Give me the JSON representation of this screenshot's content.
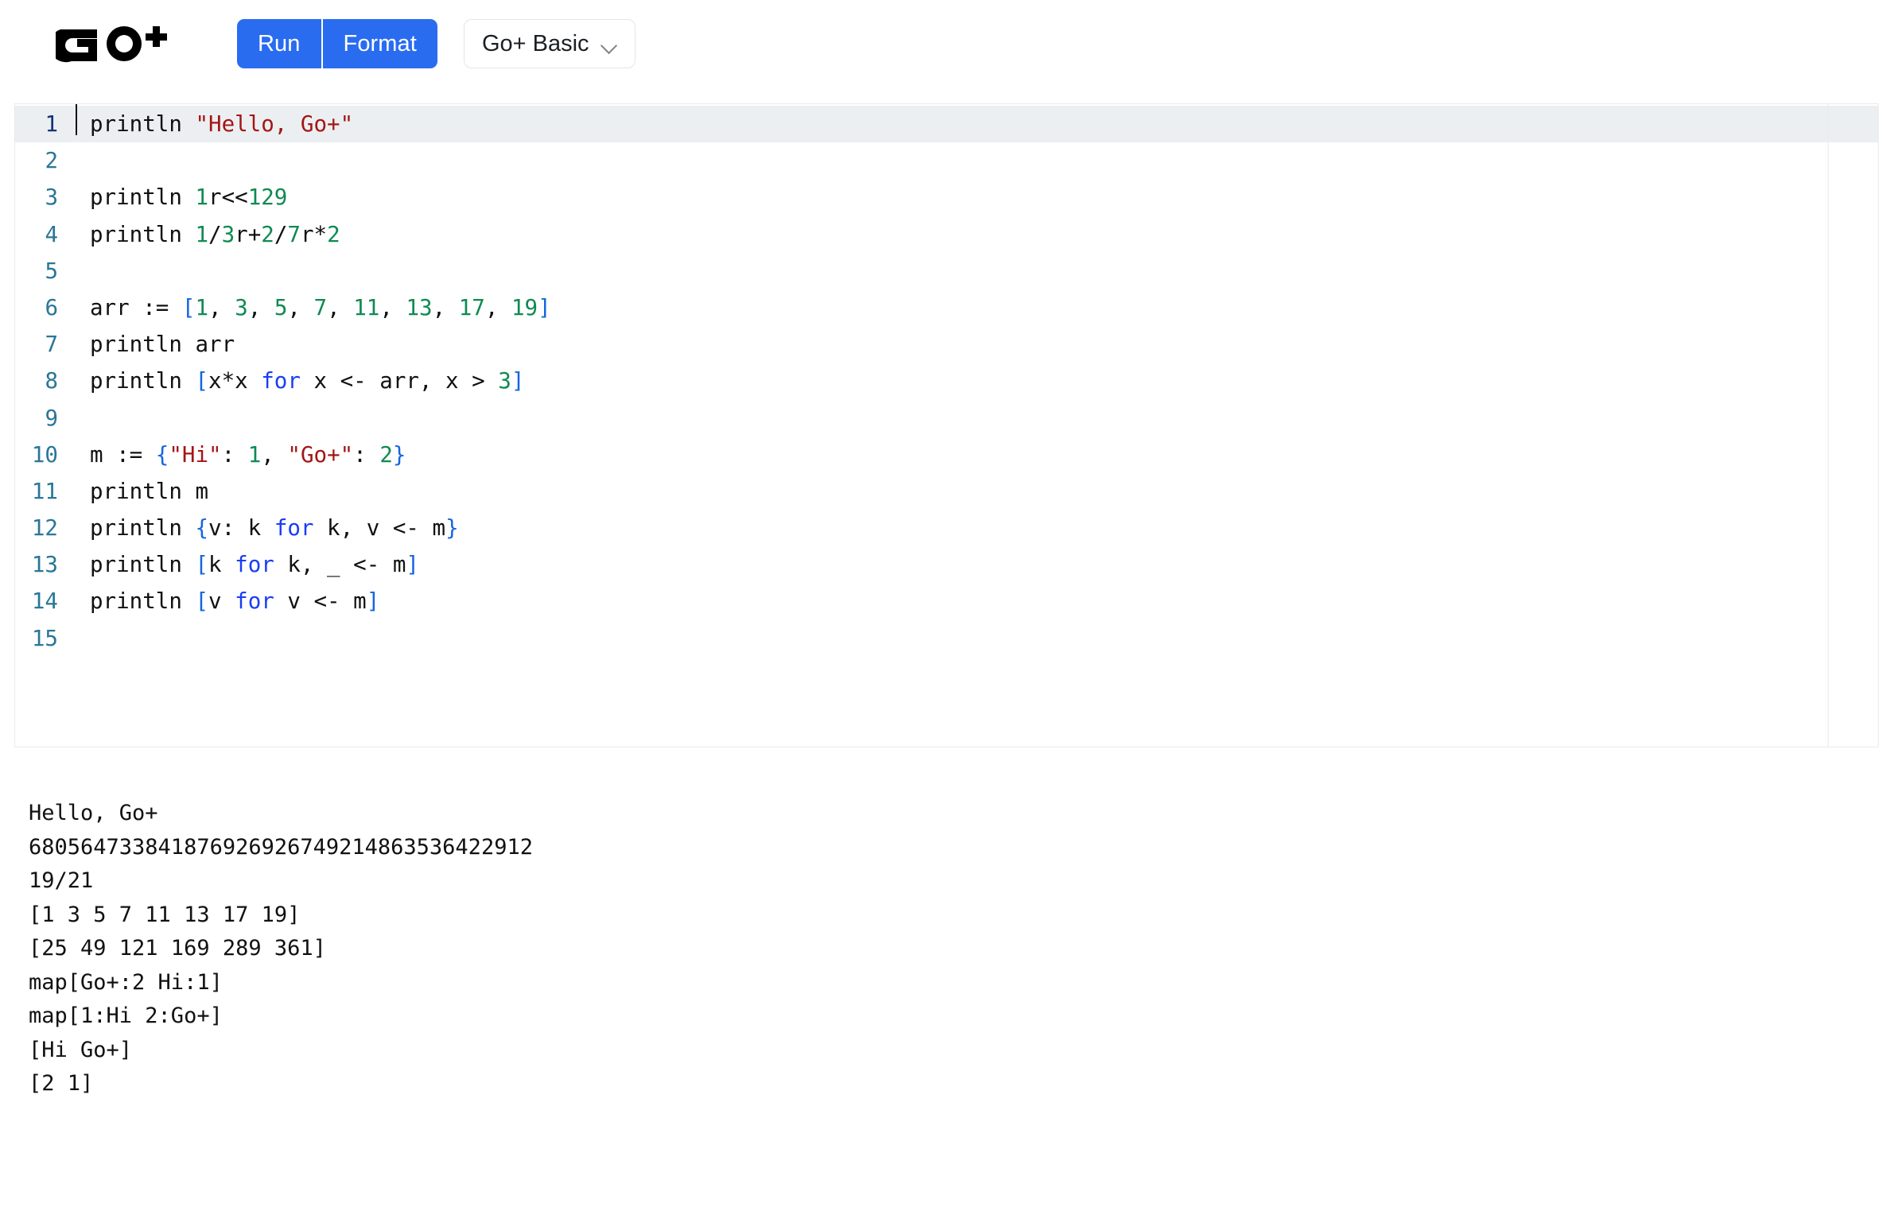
{
  "app": {
    "logo_text": "GO+",
    "logo_icon": "goplus-logo"
  },
  "toolbar": {
    "run_label": "Run",
    "format_label": "Format",
    "mode": {
      "selected": "Go+ Basic",
      "chevron_icon": "chevron-down-icon"
    },
    "accent_color": "#2a6cf0"
  },
  "editor": {
    "active_line": 1,
    "total_lines": 15,
    "language": "Go+",
    "syntax_colors": {
      "string": "#a41515",
      "number": "#0f8a52",
      "bracket": "#1565e0",
      "keyword": "#1a3df5",
      "plain": "#111111",
      "line_number": "#2a7697",
      "line_number_active": "#13337a",
      "active_line_bg": "#eceff1"
    },
    "lines": [
      {
        "n": "1",
        "tokens": [
          {
            "t": "println ",
            "c": "pln"
          },
          {
            "t": "\"Hello, Go+\"",
            "c": "str"
          }
        ]
      },
      {
        "n": "2",
        "tokens": []
      },
      {
        "n": "3",
        "tokens": [
          {
            "t": "println ",
            "c": "pln"
          },
          {
            "t": "1",
            "c": "num"
          },
          {
            "t": "r<<",
            "c": "pln"
          },
          {
            "t": "129",
            "c": "num"
          }
        ]
      },
      {
        "n": "4",
        "tokens": [
          {
            "t": "println ",
            "c": "pln"
          },
          {
            "t": "1",
            "c": "num"
          },
          {
            "t": "/",
            "c": "pln"
          },
          {
            "t": "3",
            "c": "num"
          },
          {
            "t": "r+",
            "c": "pln"
          },
          {
            "t": "2",
            "c": "num"
          },
          {
            "t": "/",
            "c": "pln"
          },
          {
            "t": "7",
            "c": "num"
          },
          {
            "t": "r*",
            "c": "pln"
          },
          {
            "t": "2",
            "c": "num"
          }
        ]
      },
      {
        "n": "5",
        "tokens": []
      },
      {
        "n": "6",
        "tokens": [
          {
            "t": "arr := ",
            "c": "pln"
          },
          {
            "t": "[",
            "c": "brk"
          },
          {
            "t": "1",
            "c": "num"
          },
          {
            "t": ", ",
            "c": "pln"
          },
          {
            "t": "3",
            "c": "num"
          },
          {
            "t": ", ",
            "c": "pln"
          },
          {
            "t": "5",
            "c": "num"
          },
          {
            "t": ", ",
            "c": "pln"
          },
          {
            "t": "7",
            "c": "num"
          },
          {
            "t": ", ",
            "c": "pln"
          },
          {
            "t": "11",
            "c": "num"
          },
          {
            "t": ", ",
            "c": "pln"
          },
          {
            "t": "13",
            "c": "num"
          },
          {
            "t": ", ",
            "c": "pln"
          },
          {
            "t": "17",
            "c": "num"
          },
          {
            "t": ", ",
            "c": "pln"
          },
          {
            "t": "19",
            "c": "num"
          },
          {
            "t": "]",
            "c": "brk"
          }
        ]
      },
      {
        "n": "7",
        "tokens": [
          {
            "t": "println arr",
            "c": "pln"
          }
        ]
      },
      {
        "n": "8",
        "tokens": [
          {
            "t": "println ",
            "c": "pln"
          },
          {
            "t": "[",
            "c": "brk"
          },
          {
            "t": "x*x ",
            "c": "pln"
          },
          {
            "t": "for",
            "c": "kw"
          },
          {
            "t": " x <- arr, x > ",
            "c": "pln"
          },
          {
            "t": "3",
            "c": "num"
          },
          {
            "t": "]",
            "c": "brk"
          }
        ]
      },
      {
        "n": "9",
        "tokens": []
      },
      {
        "n": "10",
        "tokens": [
          {
            "t": "m := ",
            "c": "pln"
          },
          {
            "t": "{",
            "c": "brk"
          },
          {
            "t": "\"Hi\"",
            "c": "str"
          },
          {
            "t": ": ",
            "c": "pln"
          },
          {
            "t": "1",
            "c": "num"
          },
          {
            "t": ", ",
            "c": "pln"
          },
          {
            "t": "\"Go+\"",
            "c": "str"
          },
          {
            "t": ": ",
            "c": "pln"
          },
          {
            "t": "2",
            "c": "num"
          },
          {
            "t": "}",
            "c": "brk"
          }
        ]
      },
      {
        "n": "11",
        "tokens": [
          {
            "t": "println m",
            "c": "pln"
          }
        ]
      },
      {
        "n": "12",
        "tokens": [
          {
            "t": "println ",
            "c": "pln"
          },
          {
            "t": "{",
            "c": "brk"
          },
          {
            "t": "v: k ",
            "c": "pln"
          },
          {
            "t": "for",
            "c": "kw"
          },
          {
            "t": " k, v <- m",
            "c": "pln"
          },
          {
            "t": "}",
            "c": "brk"
          }
        ]
      },
      {
        "n": "13",
        "tokens": [
          {
            "t": "println ",
            "c": "pln"
          },
          {
            "t": "[",
            "c": "brk"
          },
          {
            "t": "k ",
            "c": "pln"
          },
          {
            "t": "for",
            "c": "kw"
          },
          {
            "t": " k, _ <- m",
            "c": "pln"
          },
          {
            "t": "]",
            "c": "brk"
          }
        ]
      },
      {
        "n": "14",
        "tokens": [
          {
            "t": "println ",
            "c": "pln"
          },
          {
            "t": "[",
            "c": "brk"
          },
          {
            "t": "v ",
            "c": "pln"
          },
          {
            "t": "for",
            "c": "kw"
          },
          {
            "t": " v <- m",
            "c": "pln"
          },
          {
            "t": "]",
            "c": "brk"
          }
        ]
      },
      {
        "n": "15",
        "tokens": []
      }
    ]
  },
  "console": {
    "lines": [
      "Hello, Go+",
      "680564733841876926926749214863536422912",
      "19/21",
      "[1 3 5 7 11 13 17 19]",
      "[25 49 121 169 289 361]",
      "map[Go+:2 Hi:1]",
      "map[1:Hi 2:Go+]",
      "[Hi Go+]",
      "[2 1]"
    ]
  }
}
